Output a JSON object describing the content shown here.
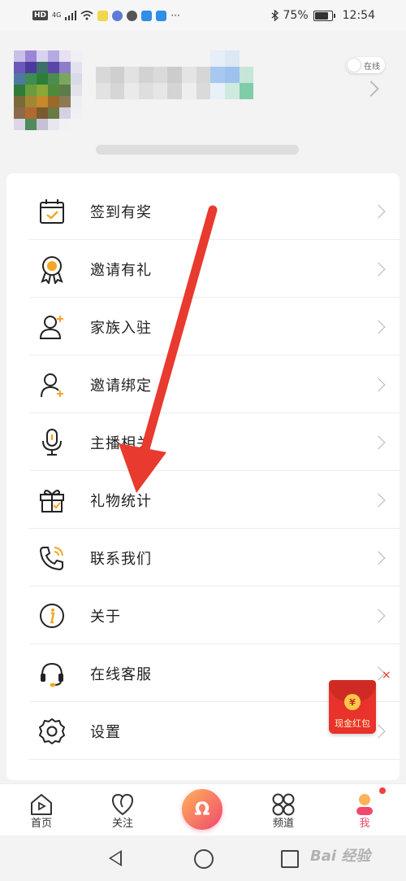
{
  "statusbar": {
    "left_chip": "HD",
    "signal_tiny": "4G",
    "battery_pct": "75%",
    "time": "12:54",
    "icons": [
      "wifi-icon",
      "weibo-icon",
      "music-icon",
      "chat-icon",
      "cloud-icon",
      "cloud2-icon",
      "more-icon",
      "bluetooth-icon",
      "battery-icon"
    ]
  },
  "profile": {
    "online_toggle_label": "在线"
  },
  "menu": {
    "items": [
      {
        "label": "签到有奖",
        "icon": "calendar-check-icon"
      },
      {
        "label": "邀请有礼",
        "icon": "award-medal-icon"
      },
      {
        "label": "家族入驻",
        "icon": "user-add-icon"
      },
      {
        "label": "邀请绑定",
        "icon": "user-plus-icon"
      },
      {
        "label": "主播相关",
        "icon": "microphone-icon"
      },
      {
        "label": "礼物统计",
        "icon": "gift-icon"
      },
      {
        "label": "联系我们",
        "icon": "phone-icon"
      },
      {
        "label": "关于",
        "icon": "info-icon"
      },
      {
        "label": "在线客服",
        "icon": "headset-icon"
      },
      {
        "label": "设置",
        "icon": "gear-icon"
      }
    ]
  },
  "redpack": {
    "coin": "¥",
    "label": "现金红包",
    "close": "×"
  },
  "bottomnav": {
    "items": [
      {
        "label": "首页",
        "icon": "home-play-icon"
      },
      {
        "label": "关注",
        "icon": "heart-icon"
      },
      {
        "label": "",
        "icon": "center-logo-icon"
      },
      {
        "label": "频道",
        "icon": "channel-grid-icon"
      },
      {
        "label": "我",
        "icon": "me-icon"
      }
    ],
    "center_symbol": "Ω"
  },
  "watermark": "Bai 经验",
  "colors": {
    "accent_orange": "#f5a623",
    "active_tab": "#f0486e",
    "annotation_arrow": "#e83a2e"
  }
}
